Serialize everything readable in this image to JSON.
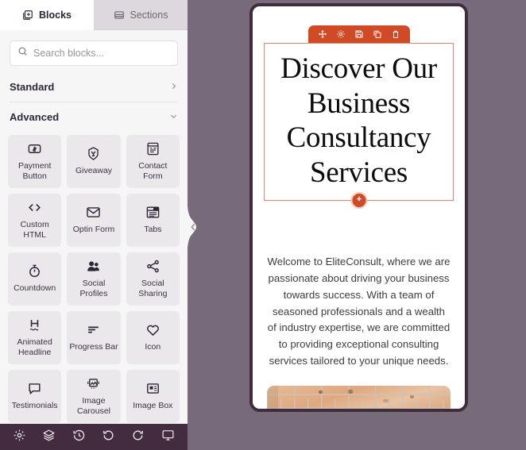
{
  "sidebar": {
    "tabs": [
      {
        "label": "Blocks",
        "icon": "blocks-icon",
        "active": true
      },
      {
        "label": "Sections",
        "icon": "sections-icon",
        "active": false
      }
    ],
    "search": {
      "placeholder": "Search blocks...",
      "value": "",
      "icon": "search-icon"
    },
    "categories": [
      {
        "label": "Standard",
        "state": "collapsed",
        "icon": "chevron-right-icon"
      },
      {
        "label": "Advanced",
        "state": "expanded",
        "icon": "chevron-down-icon"
      }
    ],
    "blocks": [
      {
        "label": "Payment Button",
        "icon": "payment-button-icon"
      },
      {
        "label": "Giveaway",
        "icon": "giveaway-icon"
      },
      {
        "label": "Contact Form",
        "icon": "contact-form-icon"
      },
      {
        "label": "Custom HTML",
        "icon": "code-brackets-icon"
      },
      {
        "label": "Optin Form",
        "icon": "envelope-icon"
      },
      {
        "label": "Tabs",
        "icon": "tabs-icon"
      },
      {
        "label": "Countdown",
        "icon": "stopwatch-icon"
      },
      {
        "label": "Social Profiles",
        "icon": "people-icon"
      },
      {
        "label": "Social Sharing",
        "icon": "share-icon"
      },
      {
        "label": "Animated Headline",
        "icon": "animated-headline-icon"
      },
      {
        "label": "Progress Bar",
        "icon": "progress-bar-icon"
      },
      {
        "label": "Icon",
        "icon": "heart-icon"
      },
      {
        "label": "Testimonials",
        "icon": "speech-bubble-icon"
      },
      {
        "label": "Image Carousel",
        "icon": "image-carousel-icon"
      },
      {
        "label": "Image Box",
        "icon": "image-box-icon"
      }
    ],
    "collapse_handle": {
      "icon": "chevron-left-icon"
    }
  },
  "bottom_toolbar": {
    "buttons": [
      {
        "name": "settings",
        "icon": "gear-icon"
      },
      {
        "name": "layers",
        "icon": "layers-icon"
      },
      {
        "name": "revision-history",
        "icon": "history-icon"
      },
      {
        "name": "undo",
        "icon": "undo-icon"
      },
      {
        "name": "redo",
        "icon": "redo-icon"
      },
      {
        "name": "preview",
        "icon": "monitor-icon"
      }
    ]
  },
  "preview": {
    "block_toolbar": [
      {
        "name": "move",
        "icon": "move-arrows-icon"
      },
      {
        "name": "settings",
        "icon": "gear-icon"
      },
      {
        "name": "save",
        "icon": "save-icon"
      },
      {
        "name": "duplicate",
        "icon": "duplicate-icon"
      },
      {
        "name": "delete",
        "icon": "trash-icon"
      }
    ],
    "hero": {
      "title": "Discover Our Business Consultancy Services",
      "paragraph": "Welcome to EliteConsult, where we are passionate about driving your business towards success. With a team of seasoned professionals and a wealth of industry expertise, we are committed to providing exceptional consulting services tailored to your unique needs.",
      "add_block_icon": "plus-circle-icon",
      "image_alt": "brick-wall-image"
    }
  },
  "colors": {
    "canvas_background": "#776a7a",
    "sidebar_background": "#f7f6f7",
    "bottom_toolbar": "#432c3f",
    "accent_orange": "#d04a26",
    "block_border": "#e8806a",
    "device_frame": "#402c3c"
  }
}
